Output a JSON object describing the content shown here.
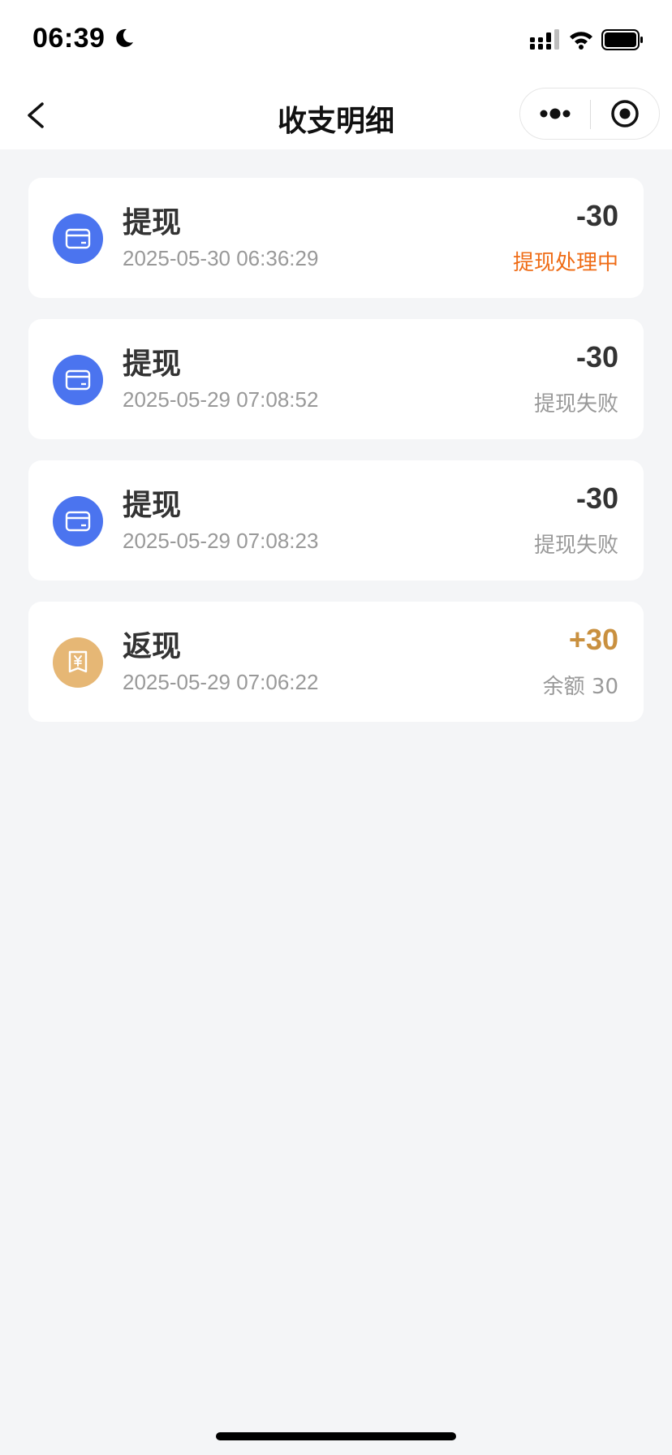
{
  "status_bar": {
    "time": "06:39",
    "icons": [
      "moon-icon",
      "signal-icon",
      "wifi-icon",
      "battery-icon"
    ]
  },
  "nav": {
    "title": "收支明细",
    "icons": [
      "back-arrow-icon",
      "more-dots-icon",
      "close-target-icon"
    ]
  },
  "records": [
    {
      "title": "提现",
      "time": "2025-05-30 06:36:29",
      "amount": "-30",
      "status": "提现处理中",
      "icon": "card-icon",
      "status_type": "processing"
    },
    {
      "title": "提现",
      "time": "2025-05-29 07:08:52",
      "amount": "-30",
      "status": "提现失败",
      "icon": "card-icon",
      "status_type": "failed"
    },
    {
      "title": "提现",
      "time": "2025-05-29 07:08:23",
      "amount": "-30",
      "status": "提现失败",
      "icon": "card-icon",
      "status_type": "failed"
    },
    {
      "title": "返现",
      "time": "2025-05-29 07:06:22",
      "amount": "+30",
      "status": "余额 30",
      "icon": "yuan-receipt-icon",
      "status_type": "balance"
    }
  ],
  "colors": {
    "card_icon_bg": "#4b74ef",
    "cashback_icon_bg": "#e6b775",
    "processing_status": "#ef6c16",
    "positive_amount": "#c9903f"
  }
}
